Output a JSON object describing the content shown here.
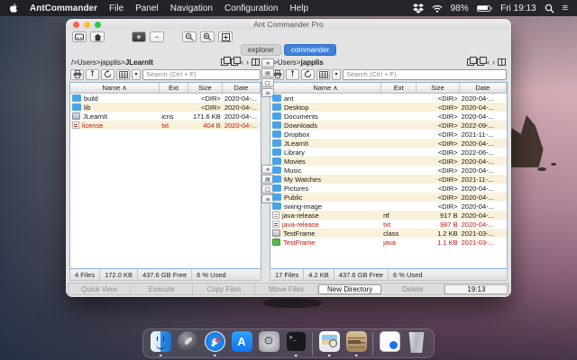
{
  "menu_bar": {
    "app_name": "AntCommander",
    "items": [
      "File",
      "Panel",
      "Navigation",
      "Configuration",
      "Help"
    ],
    "battery": "98%",
    "clock": "Fri 19:13"
  },
  "window": {
    "title": "Ant Commander Pro",
    "tabs": [
      {
        "label": "explorer",
        "active": false
      },
      {
        "label": "commander",
        "active": true
      }
    ]
  },
  "columns": [
    "Name",
    "Ext",
    "Size",
    "Date"
  ],
  "sort_indicator": "∧",
  "left_pane": {
    "path_prefix": "/>Users>japplis>",
    "path_current": "JLearnIt",
    "search_placeholder": "Search (Ctrl + F)",
    "rows": [
      {
        "name": "build",
        "ext": "",
        "size": "<DIR>",
        "date": "2020-04-...",
        "icon": "folder",
        "red": false
      },
      {
        "name": "lib",
        "ext": "",
        "size": "<DIR>",
        "date": "2020-04-...",
        "icon": "folder",
        "red": false
      },
      {
        "name": "JLearnIt",
        "ext": "icns",
        "size": "171.6 KB",
        "date": "2020-04-...",
        "icon": "app",
        "red": false
      },
      {
        "name": "license",
        "ext": "txt",
        "size": "404 B",
        "date": "2020-04-...",
        "icon": "text",
        "red": true
      }
    ],
    "status": [
      "4 Files",
      "172.0 KB",
      "437.6 GB Free",
      "6 % Used"
    ]
  },
  "right_pane": {
    "path_prefix": "/>Users>",
    "path_current": "japplis",
    "search_placeholder": "Search (Ctrl + F)",
    "rows": [
      {
        "name": "ant",
        "ext": "",
        "size": "<DIR>",
        "date": "2020-04-...",
        "icon": "folder",
        "red": false
      },
      {
        "name": "Desktop",
        "ext": "",
        "size": "<DIR>",
        "date": "2020-04-...",
        "icon": "folder",
        "red": false
      },
      {
        "name": "Documents",
        "ext": "",
        "size": "<DIR>",
        "date": "2020-04-...",
        "icon": "folder",
        "red": false
      },
      {
        "name": "Downloads",
        "ext": "",
        "size": "<DIR>",
        "date": "2022-09-...",
        "icon": "folder",
        "red": false
      },
      {
        "name": "Dropbox",
        "ext": "",
        "size": "<DIR>",
        "date": "2021-11-...",
        "icon": "folder",
        "red": false
      },
      {
        "name": "JLearnIt",
        "ext": "",
        "size": "<DIR>",
        "date": "2020-04-...",
        "icon": "folder",
        "red": false
      },
      {
        "name": "Library",
        "ext": "",
        "size": "<DIR>",
        "date": "2022-06-...",
        "icon": "folder",
        "red": false
      },
      {
        "name": "Movies",
        "ext": "",
        "size": "<DIR>",
        "date": "2020-04-...",
        "icon": "folder",
        "red": false
      },
      {
        "name": "Music",
        "ext": "",
        "size": "<DIR>",
        "date": "2020-04-...",
        "icon": "folder",
        "red": false
      },
      {
        "name": "My Watches",
        "ext": "",
        "size": "<DIR>",
        "date": "2021-11-...",
        "icon": "folder",
        "red": false
      },
      {
        "name": "Pictures",
        "ext": "",
        "size": "<DIR>",
        "date": "2020-04-...",
        "icon": "folder",
        "red": false
      },
      {
        "name": "Public",
        "ext": "",
        "size": "<DIR>",
        "date": "2020-04-...",
        "icon": "folder",
        "red": false
      },
      {
        "name": "swing-image",
        "ext": "",
        "size": "<DIR>",
        "date": "2020-04-...",
        "icon": "folder",
        "red": false
      },
      {
        "name": "java-release",
        "ext": "rtf",
        "size": "917 B",
        "date": "2020-04-...",
        "icon": "doc",
        "red": false
      },
      {
        "name": "java-release",
        "ext": "txt",
        "size": "987 B",
        "date": "2020-04-...",
        "icon": "text",
        "red": true
      },
      {
        "name": "TestFrame",
        "ext": "class",
        "size": "1.2 KB",
        "date": "2021-03-...",
        "icon": "class",
        "red": false
      },
      {
        "name": "TestFrame",
        "ext": "java",
        "size": "1.1 KB",
        "date": "2021-03-...",
        "icon": "java",
        "red": true
      }
    ],
    "status": [
      "17 Files",
      "4.2 KB",
      "437.6 GB Free",
      "6 % Used"
    ]
  },
  "function_bar": [
    {
      "label": "Quick View",
      "style": "flat"
    },
    {
      "label": "Execute",
      "style": "flat"
    },
    {
      "label": "Copy Files",
      "style": "flat"
    },
    {
      "label": "Move Files",
      "style": "flat"
    },
    {
      "label": "New Directory",
      "style": "raised"
    },
    {
      "label": "Delete",
      "style": "flat"
    },
    {
      "label": "19:13",
      "style": "clock"
    }
  ],
  "dock": [
    {
      "name": "finder",
      "running": true
    },
    {
      "name": "launchpad",
      "running": false
    },
    {
      "name": "safari",
      "running": true
    },
    {
      "name": "appstore",
      "running": false
    },
    {
      "name": "prefs",
      "running": false
    },
    {
      "name": "terminal",
      "running": true
    },
    {
      "name": "divider"
    },
    {
      "name": "preview",
      "running": true
    },
    {
      "name": "cabinet",
      "running": true
    },
    {
      "name": "divider"
    },
    {
      "name": "document",
      "running": false
    },
    {
      "name": "trash",
      "running": false
    }
  ],
  "colors": {
    "accent": "#3f80d8",
    "row_stripe": "#faf1da",
    "alert_text": "#c0180c",
    "table_border": "#8fb3d9",
    "folder_icon": "#4aa3e8"
  }
}
